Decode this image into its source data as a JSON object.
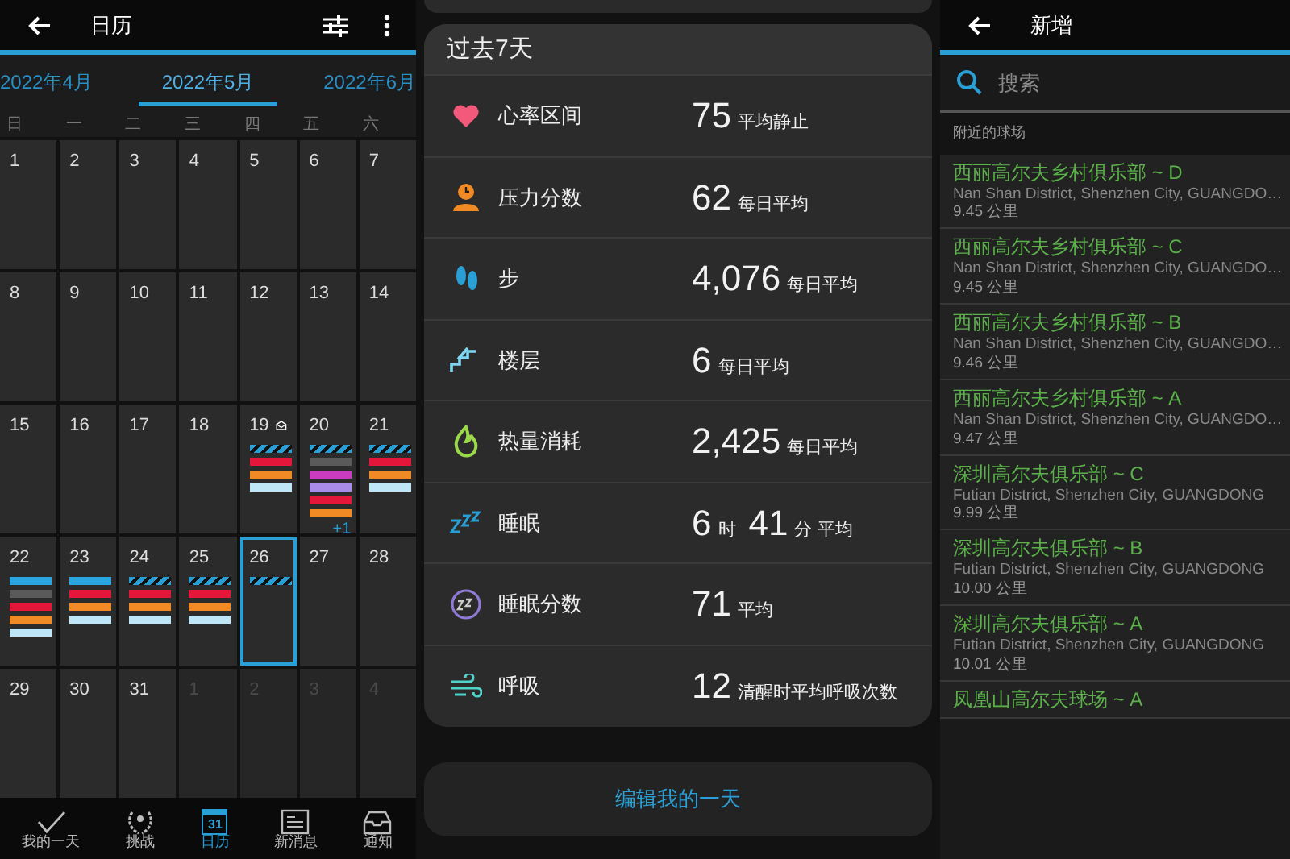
{
  "calendar_screen": {
    "title": "日历",
    "months": [
      {
        "label": "2022年4月",
        "selected": false
      },
      {
        "label": "2022年5月",
        "selected": true
      },
      {
        "label": "2022年6月",
        "selected": false
      }
    ],
    "weekdays": [
      "日",
      "一",
      "二",
      "三",
      "四",
      "五",
      "六"
    ],
    "days": [
      {
        "label": "1",
        "in_month": true,
        "selected": false
      },
      {
        "label": "2",
        "in_month": true,
        "selected": false
      },
      {
        "label": "3",
        "in_month": true,
        "selected": false
      },
      {
        "label": "4",
        "in_month": true,
        "selected": false
      },
      {
        "label": "5",
        "in_month": true,
        "selected": false
      },
      {
        "label": "6",
        "in_month": true,
        "selected": false
      },
      {
        "label": "7",
        "in_month": true,
        "selected": false
      },
      {
        "label": "8",
        "in_month": true,
        "selected": false
      },
      {
        "label": "9",
        "in_month": true,
        "selected": false
      },
      {
        "label": "10",
        "in_month": true,
        "selected": false
      },
      {
        "label": "11",
        "in_month": true,
        "selected": false
      },
      {
        "label": "12",
        "in_month": true,
        "selected": false
      },
      {
        "label": "13",
        "in_month": true,
        "selected": false
      },
      {
        "label": "14",
        "in_month": true,
        "selected": false
      },
      {
        "label": "15",
        "in_month": true,
        "selected": false
      },
      {
        "label": "16",
        "in_month": true,
        "selected": false
      },
      {
        "label": "17",
        "in_month": true,
        "selected": false
      },
      {
        "label": "18",
        "in_month": true,
        "selected": false
      },
      {
        "label": "19",
        "in_month": true,
        "selected": false,
        "badge": true,
        "events": [
          {
            "kind": "striped",
            "color": "#2a9fd6"
          },
          {
            "kind": "bar",
            "color": "#e4163a"
          },
          {
            "kind": "bar",
            "color": "#f08a24"
          },
          {
            "kind": "bar",
            "color": "#bfe6f7"
          }
        ]
      },
      {
        "label": "20",
        "in_month": true,
        "selected": false,
        "more": "+1",
        "events": [
          {
            "kind": "striped",
            "color": "#2a9fd6"
          },
          {
            "kind": "bar",
            "color": "#5a5a5a"
          },
          {
            "kind": "bar",
            "color": "#c93bbf"
          },
          {
            "kind": "bar",
            "color": "#a98be8"
          },
          {
            "kind": "bar",
            "color": "#e4163a"
          },
          {
            "kind": "bar",
            "color": "#f08a24"
          }
        ]
      },
      {
        "label": "21",
        "in_month": true,
        "selected": false,
        "events": [
          {
            "kind": "striped",
            "color": "#2a9fd6"
          },
          {
            "kind": "bar",
            "color": "#e4163a"
          },
          {
            "kind": "bar",
            "color": "#f08a24"
          },
          {
            "kind": "bar",
            "color": "#bfe6f7"
          }
        ]
      },
      {
        "label": "22",
        "in_month": true,
        "selected": false,
        "events": [
          {
            "kind": "bar",
            "color": "#29a6e0"
          },
          {
            "kind": "bar",
            "color": "#5a5a5a"
          },
          {
            "kind": "bar",
            "color": "#e4163a"
          },
          {
            "kind": "bar",
            "color": "#f08a24"
          },
          {
            "kind": "bar",
            "color": "#bfe6f7"
          }
        ]
      },
      {
        "label": "23",
        "in_month": true,
        "selected": false,
        "events": [
          {
            "kind": "bar",
            "color": "#29a6e0"
          },
          {
            "kind": "bar",
            "color": "#e4163a"
          },
          {
            "kind": "bar",
            "color": "#f08a24"
          },
          {
            "kind": "bar",
            "color": "#bfe6f7"
          }
        ]
      },
      {
        "label": "24",
        "in_month": true,
        "selected": false,
        "events": [
          {
            "kind": "striped",
            "color": "#2a9fd6"
          },
          {
            "kind": "bar",
            "color": "#e4163a"
          },
          {
            "kind": "bar",
            "color": "#f08a24"
          },
          {
            "kind": "bar",
            "color": "#bfe6f7"
          }
        ]
      },
      {
        "label": "25",
        "in_month": true,
        "selected": false,
        "events": [
          {
            "kind": "striped",
            "color": "#2a9fd6"
          },
          {
            "kind": "bar",
            "color": "#e4163a"
          },
          {
            "kind": "bar",
            "color": "#f08a24"
          },
          {
            "kind": "bar",
            "color": "#bfe6f7"
          }
        ]
      },
      {
        "label": "26",
        "in_month": true,
        "selected": true,
        "events": [
          {
            "kind": "striped",
            "color": "#2a9fd6"
          }
        ]
      },
      {
        "label": "27",
        "in_month": true,
        "selected": false
      },
      {
        "label": "28",
        "in_month": true,
        "selected": false
      },
      {
        "label": "29",
        "in_month": true,
        "selected": false
      },
      {
        "label": "30",
        "in_month": true,
        "selected": false
      },
      {
        "label": "31",
        "in_month": true,
        "selected": false
      },
      {
        "label": "1",
        "in_month": false,
        "selected": false
      },
      {
        "label": "2",
        "in_month": false,
        "selected": false
      },
      {
        "label": "3",
        "in_month": false,
        "selected": false
      },
      {
        "label": "4",
        "in_month": false,
        "selected": false
      }
    ],
    "nav": [
      {
        "kind": "check",
        "label": "我的一天",
        "selected": false
      },
      {
        "kind": "laurel",
        "label": "挑战",
        "selected": false
      },
      {
        "kind": "calendar",
        "label": "日历",
        "icon_text": "31",
        "selected": true
      },
      {
        "kind": "news",
        "label": "新消息",
        "selected": false
      },
      {
        "kind": "inbox",
        "label": "通知",
        "selected": false
      }
    ]
  },
  "summary_screen": {
    "title": "过去7天",
    "rows": [
      {
        "kind": "heart",
        "label": "心率区间",
        "value": [
          {
            "num": "75",
            "unit": "平均静止"
          }
        ]
      },
      {
        "kind": "stress",
        "label": "压力分数",
        "value": [
          {
            "num": "62",
            "unit": "每日平均"
          }
        ]
      },
      {
        "kind": "steps",
        "label": "步",
        "value": [
          {
            "num": "4,076",
            "unit": "每日平均"
          }
        ]
      },
      {
        "kind": "floors",
        "label": "楼层",
        "value": [
          {
            "num": "6",
            "unit": "每日平均"
          }
        ]
      },
      {
        "kind": "calories",
        "label": "热量消耗",
        "value": [
          {
            "num": "2,425",
            "unit": "每日平均"
          }
        ]
      },
      {
        "kind": "sleep",
        "label": "睡眠",
        "value": [
          {
            "num": "6",
            "unit": "时"
          },
          {
            "num": "41",
            "unit": "分 平均"
          }
        ]
      },
      {
        "kind": "sleep_score",
        "label": "睡眠分数",
        "value": [
          {
            "num": "71",
            "unit": "平均"
          }
        ]
      },
      {
        "kind": "respiration",
        "label": "呼吸",
        "value": [
          {
            "num": "12",
            "unit": "清醒时平均呼吸次数"
          }
        ]
      }
    ],
    "button": "编辑我的一天"
  },
  "course_screen": {
    "title": "新增",
    "search": {
      "placeholder": "搜索"
    },
    "section": "附近的球场",
    "courses": [
      {
        "name": "西丽高尔夫乡村俱乐部 ~ D",
        "address": "Nan Shan District, Shenzhen City, GUANGDO…",
        "distance": "9.45 公里"
      },
      {
        "name": "西丽高尔夫乡村俱乐部 ~ C",
        "address": "Nan Shan District, Shenzhen City, GUANGDO…",
        "distance": "9.45 公里"
      },
      {
        "name": "西丽高尔夫乡村俱乐部 ~ B",
        "address": "Nan Shan District, Shenzhen City, GUANGDO…",
        "distance": "9.46 公里"
      },
      {
        "name": "西丽高尔夫乡村俱乐部 ~ A",
        "address": "Nan Shan District, Shenzhen City, GUANGDO…",
        "distance": "9.47 公里"
      },
      {
        "name": "深圳高尔夫俱乐部 ~ C",
        "address": "Futian District, Shenzhen City, GUANGDONG",
        "distance": "9.99 公里"
      },
      {
        "name": "深圳高尔夫俱乐部 ~ B",
        "address": "Futian District, Shenzhen City, GUANGDONG",
        "distance": "10.00 公里"
      },
      {
        "name": "深圳高尔夫俱乐部 ~ A",
        "address": "Futian District, Shenzhen City, GUANGDONG",
        "distance": "10.01 公里"
      },
      {
        "name": "凤凰山高尔夫球场 ~ A"
      }
    ]
  }
}
